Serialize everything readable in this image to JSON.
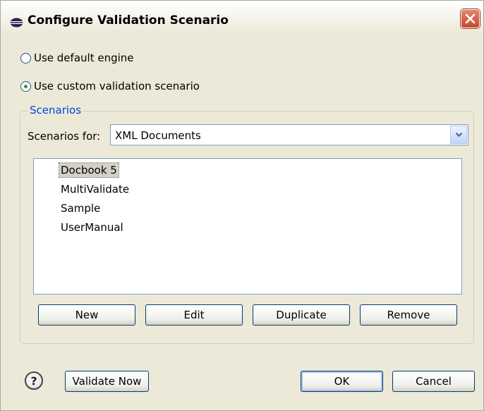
{
  "window": {
    "title": "Configure Validation Scenario",
    "close_icon": "close-icon",
    "app_icon": "eclipse-icon"
  },
  "options": {
    "default_engine": {
      "label": "Use default engine",
      "checked": false
    },
    "custom_scenario": {
      "label": "Use custom validation scenario",
      "checked": true
    }
  },
  "scenarios": {
    "group_label": "Scenarios",
    "for_label": "Scenarios for:",
    "selected_type": "XML Documents",
    "items": [
      "Docbook 5",
      "MultiValidate",
      "Sample",
      "UserManual"
    ],
    "selected_item": "Docbook 5",
    "buttons": {
      "new": "New",
      "edit": "Edit",
      "duplicate": "Duplicate",
      "remove": "Remove"
    }
  },
  "footer": {
    "help_icon": "help-icon",
    "help_glyph": "?",
    "validate_now": "Validate Now",
    "ok": "OK",
    "cancel": "Cancel"
  },
  "colors": {
    "dialog_bg": "#ece9d8",
    "group_label": "#0046d5",
    "close_button": "#c4472f",
    "radio_check": "#21a121"
  }
}
